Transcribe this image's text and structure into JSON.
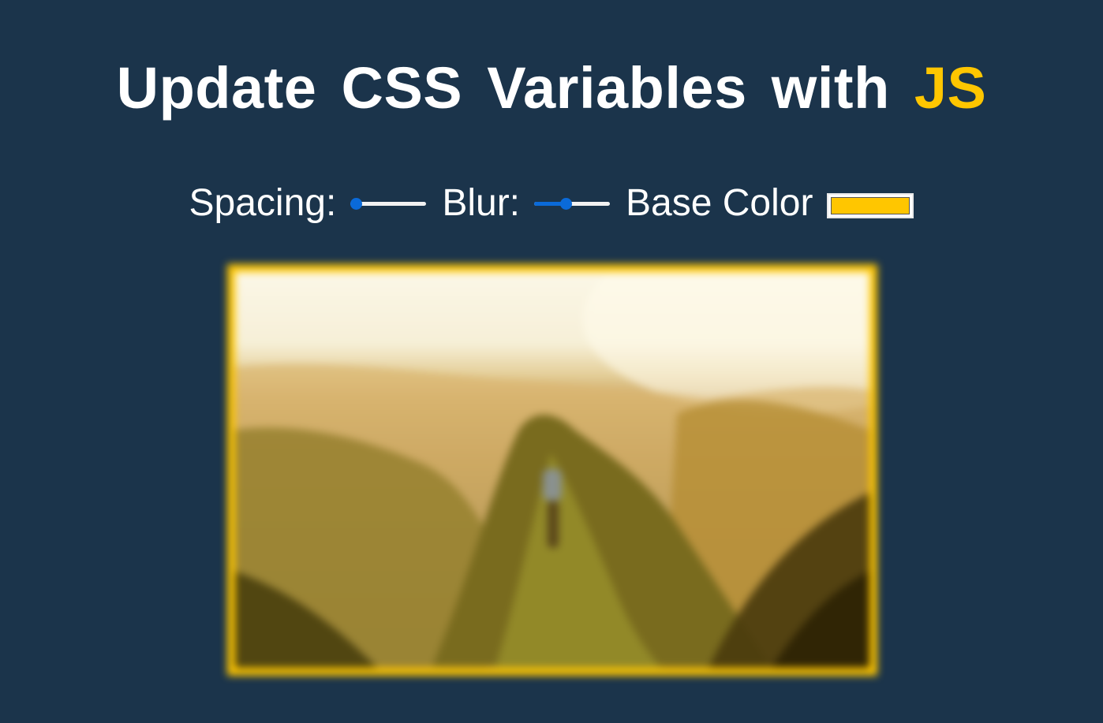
{
  "header": {
    "title_main": "Update CSS Variables with ",
    "title_highlight": "JS"
  },
  "controls": {
    "spacing": {
      "label": "Spacing:",
      "value": 0
    },
    "blur": {
      "label": "Blur:",
      "value": 0.42
    },
    "base_color": {
      "label": "Base Color",
      "value": "#ffc600"
    }
  },
  "colors": {
    "background": "#1b344b",
    "accent": "#ffc600",
    "slider_active": "#0a6ad9"
  },
  "image": {
    "description_icon": "mountain-landscape-photo"
  }
}
